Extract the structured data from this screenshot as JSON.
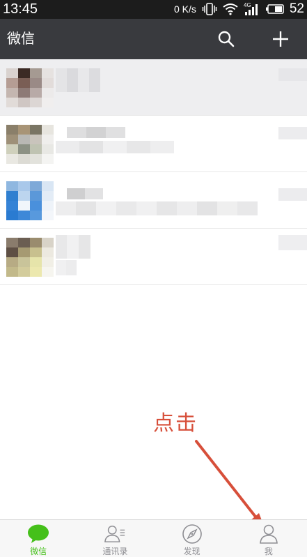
{
  "status_bar": {
    "time": "13:45",
    "network_speed": "0 K/s",
    "signal_type": "4G",
    "battery_percent": "52"
  },
  "header": {
    "title": "微信",
    "search_icon": "search-icon",
    "add_icon": "plus-icon"
  },
  "chat_list": {
    "items_count_visible": 4,
    "content_obscured": true
  },
  "annotation": {
    "label": "点击",
    "color": "#d74f3a"
  },
  "bottom_nav": {
    "tabs": [
      {
        "label": "微信",
        "icon": "chat-bubble-icon",
        "active": true
      },
      {
        "label": "通讯录",
        "icon": "contacts-icon",
        "active": false
      },
      {
        "label": "发现",
        "icon": "compass-icon",
        "active": false
      },
      {
        "label": "我",
        "icon": "person-icon",
        "active": false
      }
    ],
    "active_color": "#45c01a",
    "inactive_color": "#8e8e93"
  }
}
